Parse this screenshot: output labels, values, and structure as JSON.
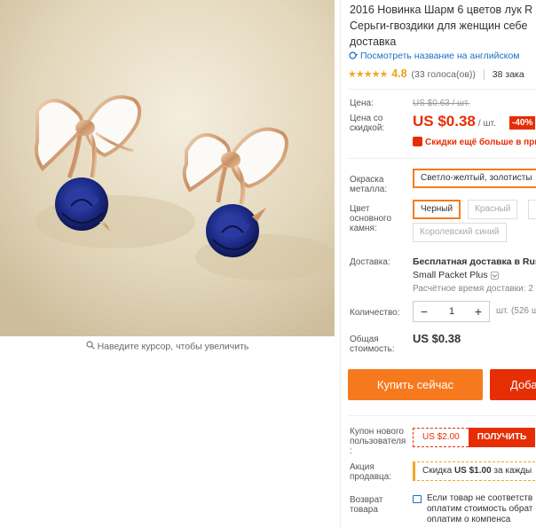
{
  "product": {
    "title_lines": [
      "2016 Новинка Шарм 6 цветов лук R",
      "Серьги-гвоздики для женщин себе",
      "доставка"
    ],
    "translate_link": "Посмотреть название на английском",
    "rating": {
      "stars": "★★★★★",
      "value": "4.8",
      "votes": "(33 голоса(ов))",
      "orders": "38 зака"
    }
  },
  "image_pane": {
    "zoom_hint": "Наведите курсор, чтобы увеличить"
  },
  "price": {
    "label_price": "Цена:",
    "old_price": "US $0.63 / шт.",
    "label_discount": "Цена со скидкой:",
    "current": "US $0.38",
    "unit": "/ шт.",
    "discount_badge": "-40%",
    "promo_text": "Скидки ещё больше в при"
  },
  "options": {
    "metal_label": "Окраска металла:",
    "metal_selected": "Светло-желтый, золотисты",
    "stone_label": "Цвет основного камня:",
    "stone_options": [
      "Черный",
      "Красный",
      "Королевский синий"
    ]
  },
  "shipping": {
    "label": "Доставка:",
    "line1": "Бесплатная доставка в Rus",
    "line2": "Small Packet Plus",
    "line3": "Расчётное время доставки: 2"
  },
  "quantity": {
    "label": "Количество:",
    "minus": "−",
    "value": "1",
    "plus": "+",
    "stock": "шт. (526 ш"
  },
  "total": {
    "label": "Общая стоимость:",
    "value": "US $0.38"
  },
  "actions": {
    "buy_now": "Купить сейчас",
    "add_to_cart": "Доба"
  },
  "coupon": {
    "label": "Купон нового пользователя :",
    "amount": "US $2.00",
    "get": "ПОЛУЧИТЬ"
  },
  "seller": {
    "label": "Акция продавца:",
    "text_pre": "Скидка ",
    "text_amount": "US $1.00",
    "text_post": " за кажды"
  },
  "returns": {
    "label": "Возврат товара",
    "line1": "Если товар не соответств",
    "line2": "оплатим стоимость обрат",
    "line3": "оплатим о компенса"
  },
  "colors": {
    "accent_orange": "#f7791e",
    "accent_red": "#e62e04",
    "link_blue": "#1b6ec7",
    "star_gold": "#f5a623"
  }
}
